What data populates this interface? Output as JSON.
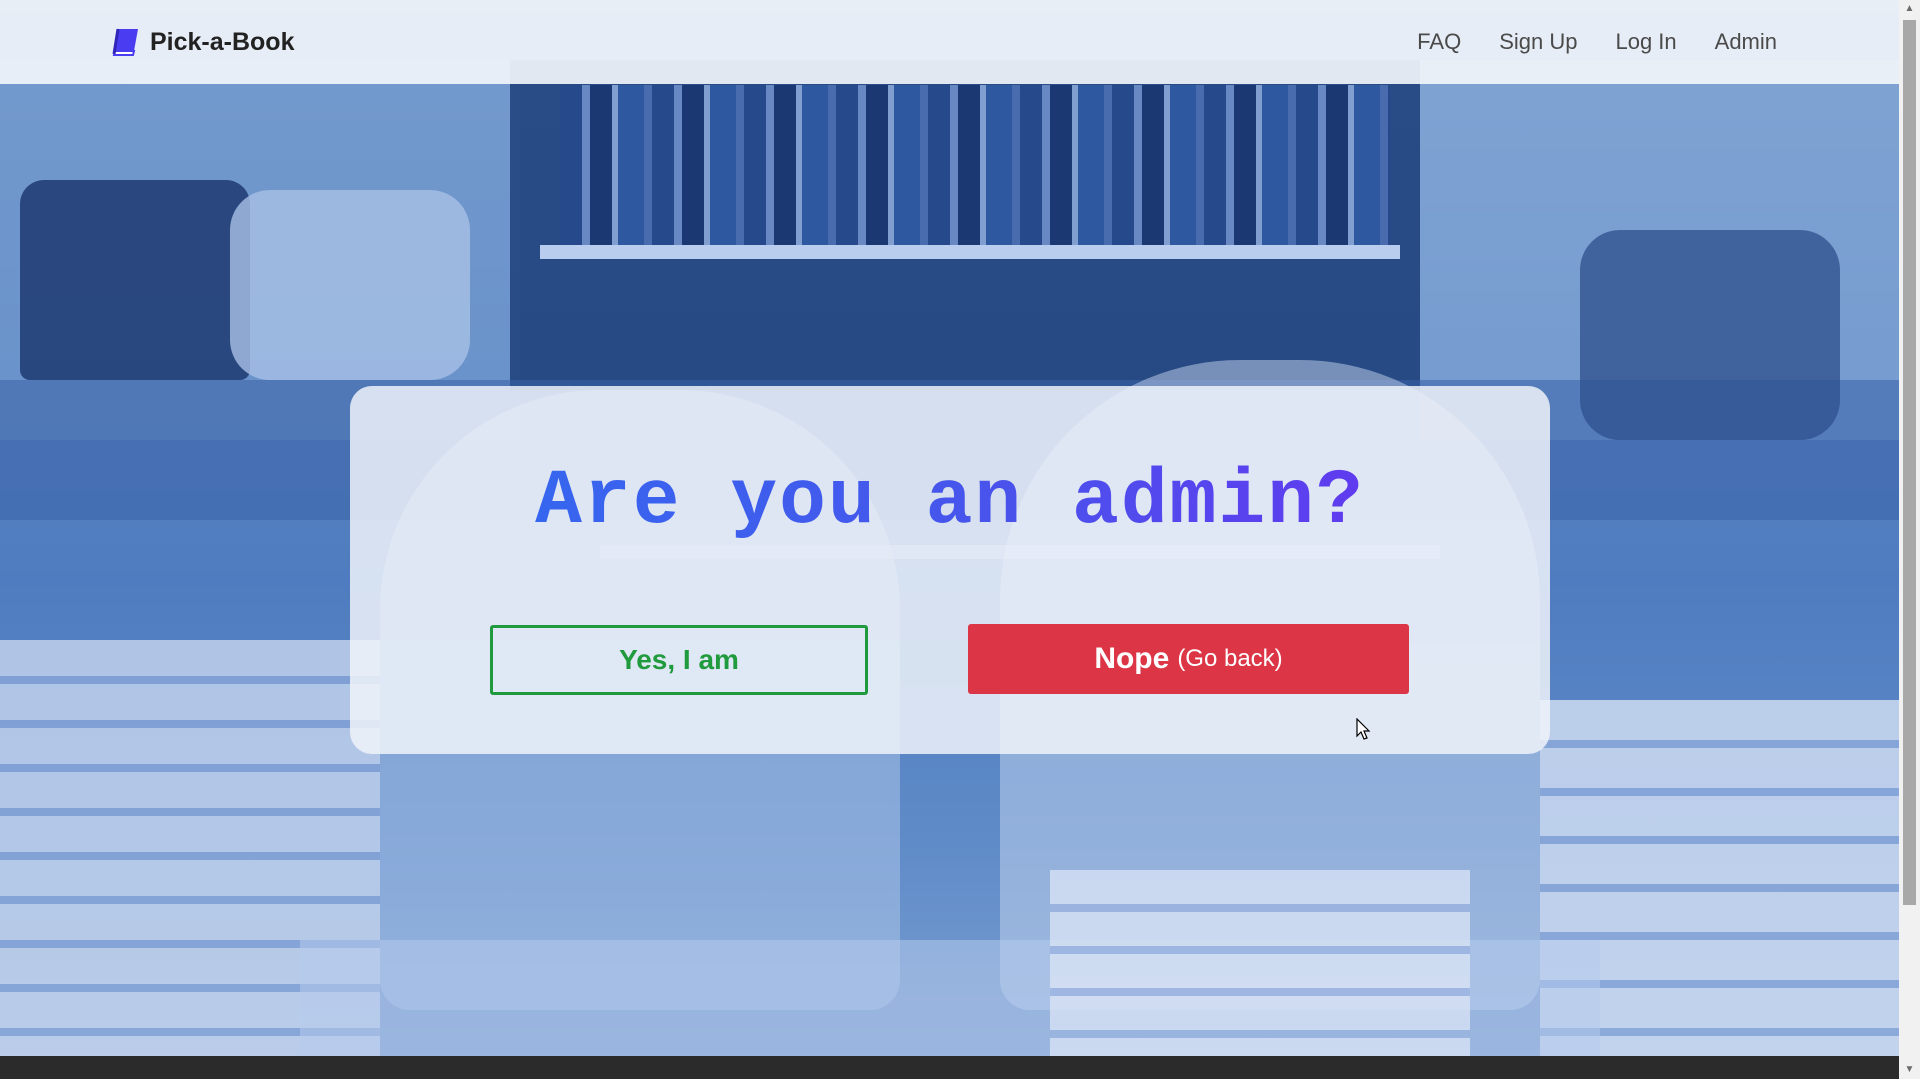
{
  "navbar": {
    "brand": "Pick-a-Book",
    "links": [
      "FAQ",
      "Sign Up",
      "Log In",
      "Admin"
    ]
  },
  "dialog": {
    "question": "Are you an admin?",
    "yes_button": "Yes, I am",
    "no_button_main": "Nope",
    "no_button_sub": "(Go back)"
  },
  "colors": {
    "brand_icon": "#4a3cf0",
    "yes_green": "#1f9a3c",
    "nope_red": "#dc3545",
    "question_gradient_start": "#2f6df0",
    "question_gradient_end": "#6b2ff0"
  },
  "icons": {
    "brand": "book-icon",
    "cursor": "mouse-pointer-icon"
  }
}
